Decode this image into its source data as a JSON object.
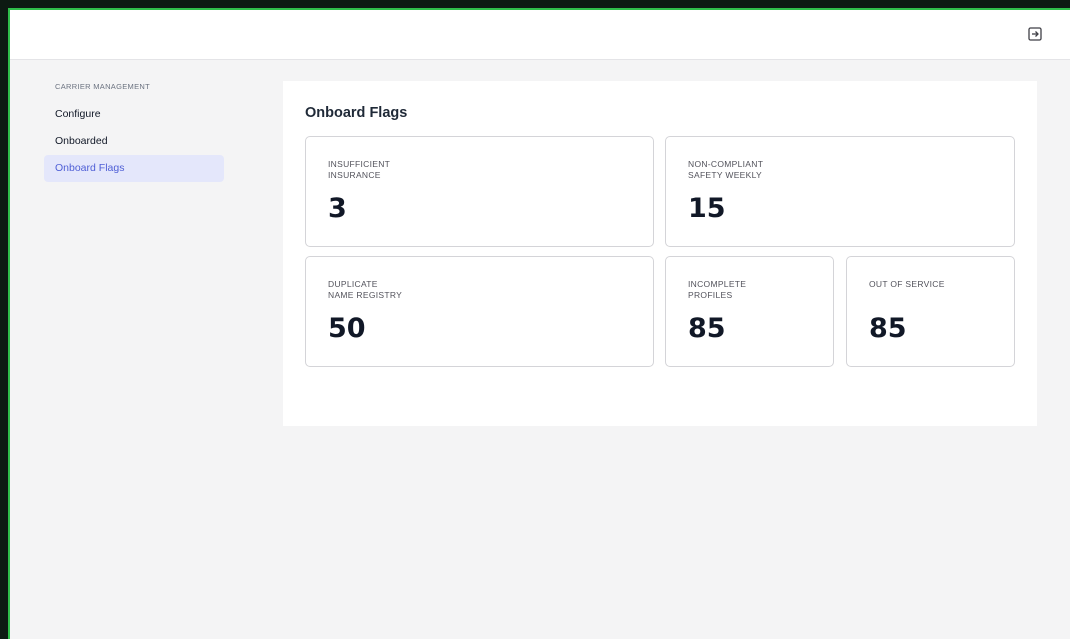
{
  "topbar": {
    "logout_icon": "logout-icon"
  },
  "sidebar": {
    "heading": "CARRIER MANAGEMENT",
    "items": [
      {
        "label": "Configure",
        "active": false
      },
      {
        "label": "Onboarded",
        "active": false
      },
      {
        "label": "Onboard Flags",
        "active": true
      }
    ]
  },
  "main": {
    "title": "Onboard Flags",
    "cards": [
      {
        "label": "INSUFFICIENT\nINSURANCE",
        "value": "3"
      },
      {
        "label": "NON-COMPLIANT\nSAFETY WEEKLY",
        "value": "15"
      },
      {
        "label": "DUPLICATE\nNAME REGISTRY",
        "value": "50"
      },
      {
        "label": "INCOMPLETE\nPROFILES",
        "value": "85"
      },
      {
        "label": "OUT OF SERVICE",
        "value": "85"
      }
    ]
  },
  "colors": {
    "accent": "#4f5fd6",
    "active_bg": "#e4e7fb",
    "frame": "#2fbf4a"
  }
}
